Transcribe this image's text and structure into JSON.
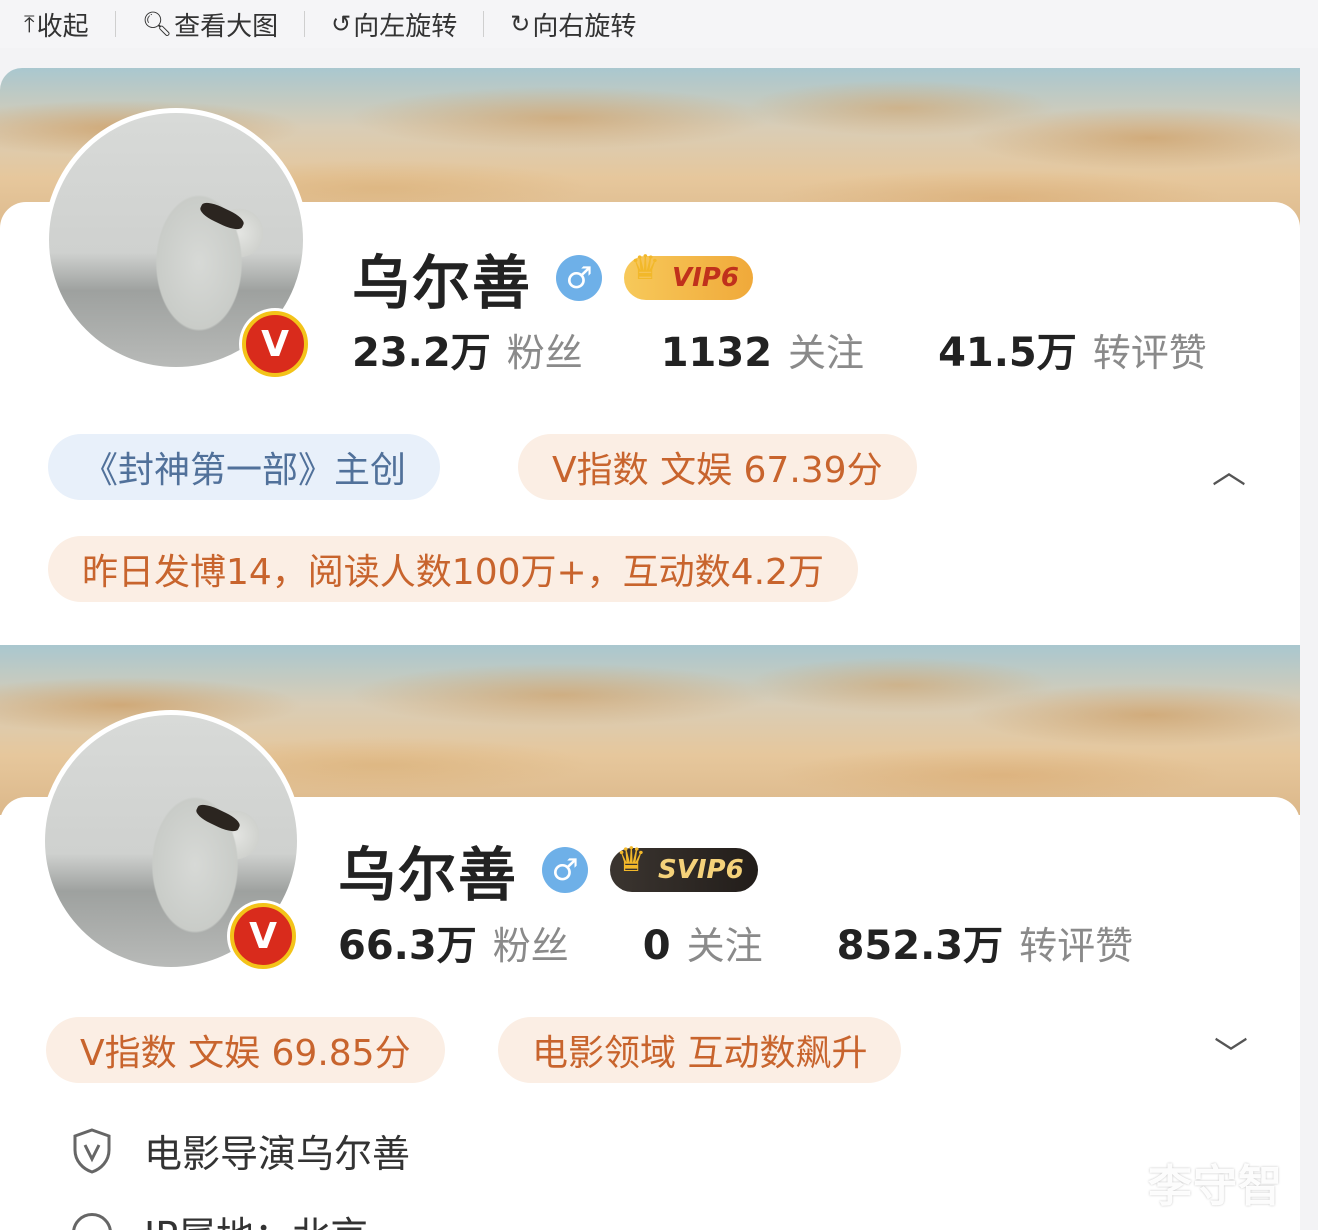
{
  "toolbar": {
    "collapse": "收起",
    "view_large": "查看大图",
    "rotate_left": "向左旋转",
    "rotate_right": "向右旋转"
  },
  "profile_top": {
    "name": "乌尔善",
    "gender_symbol": "♂",
    "vip_label": "VIP6",
    "verified_mark": "V",
    "followers_num": "23.2万",
    "followers_label": "粉丝",
    "following_num": "1132",
    "following_label": "关注",
    "interactions_num": "41.5万",
    "interactions_label": "转评赞",
    "tag_creator": "《封神第一部》主创",
    "tag_vindex": "V指数 文娱 67.39分",
    "tag_yesterday": "昨日发博14，阅读人数100万+，互动数4.2万"
  },
  "profile_bottom": {
    "name": "乌尔善",
    "gender_symbol": "♂",
    "vip_label": "SVIP6",
    "verified_mark": "V",
    "followers_num": "66.3万",
    "followers_label": "粉丝",
    "following_num": "0",
    "following_label": "关注",
    "interactions_num": "852.3万",
    "interactions_label": "转评赞",
    "tag_vindex": "V指数 文娱 69.85分",
    "tag_field": "电影领域 互动数飙升",
    "description": "电影导演乌尔善",
    "ip_location": "IP属地：北京"
  },
  "watermark": "李守智",
  "colors": {
    "accent_orange": "#c8642d",
    "tag_blue": "#51719a",
    "verified_red": "#d92b1c"
  }
}
